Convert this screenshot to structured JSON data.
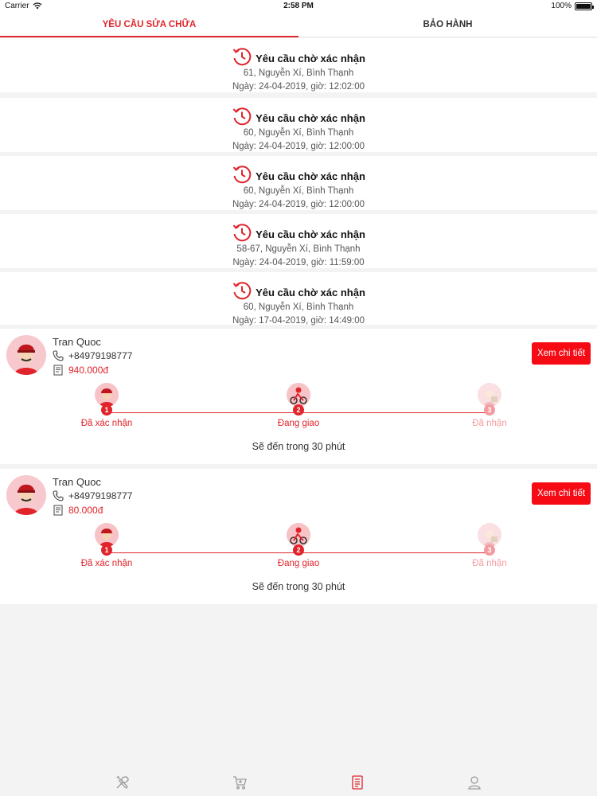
{
  "status_bar": {
    "carrier": "Carrier",
    "time": "2:58 PM",
    "battery": "100%",
    "battery_level": 1.0
  },
  "tabs": [
    {
      "label": "YÊU CẦU SỬA CHỮA",
      "active": true
    },
    {
      "label": "BẢO HÀNH",
      "active": false
    }
  ],
  "pending_requests": [
    {
      "title": "Yêu cầu chờ xác nhận",
      "address": "61, Nguyễn Xí, Bình Thạnh",
      "datetime": "Ngày: 24-04-2019, giờ: 12:02:00"
    },
    {
      "title": "Yêu cầu chờ xác nhận",
      "address": "60, Nguyễn Xí, Bình Thạnh",
      "datetime": "Ngày: 24-04-2019, giờ: 12:00:00"
    },
    {
      "title": "Yêu cầu chờ xác nhận",
      "address": "60, Nguyễn Xí, Bình Thạnh",
      "datetime": "Ngày: 24-04-2019, giờ: 12:00:00"
    },
    {
      "title": "Yêu cầu chờ xác nhận",
      "address": "58-67, Nguyễn Xí, Bình Thạnh",
      "datetime": "Ngày: 24-04-2019, giờ: 11:59:00"
    },
    {
      "title": "Yêu cầu chờ xác nhận",
      "address": "60, Nguyễn Xí, Bình Thạnh",
      "datetime": "Ngày: 17-04-2019, giờ: 14:49:00"
    }
  ],
  "orders": [
    {
      "name": "Tran Quoc",
      "phone": "+84979198777",
      "price": "940.000đ",
      "detail_label": "Xem chi tiết",
      "steps": [
        {
          "num": "1",
          "label": "Đã xác nhận",
          "done": true
        },
        {
          "num": "2",
          "label": "Đang giao",
          "done": true
        },
        {
          "num": "3",
          "label": "Đã nhận",
          "done": false
        }
      ],
      "eta": "Sẽ đến trong 30 phút"
    },
    {
      "name": "Tran Quoc",
      "phone": "+84979198777",
      "price": "80.000đ",
      "detail_label": "Xem chi tiết",
      "steps": [
        {
          "num": "1",
          "label": "Đã xác nhận",
          "done": true
        },
        {
          "num": "2",
          "label": "Đang giao",
          "done": true
        },
        {
          "num": "3",
          "label": "Đã nhận",
          "done": false
        }
      ],
      "eta": "Sẽ đến trong 30 phút"
    }
  ],
  "bottom_tabs": [
    {
      "icon": "tools-icon",
      "active": false
    },
    {
      "icon": "cart-icon",
      "active": false
    },
    {
      "icon": "document-icon",
      "active": true
    },
    {
      "icon": "user-icon",
      "active": false
    }
  ],
  "colors": {
    "accent": "#e0242b",
    "button": "#f60a14",
    "background": "#f3f3f4"
  }
}
